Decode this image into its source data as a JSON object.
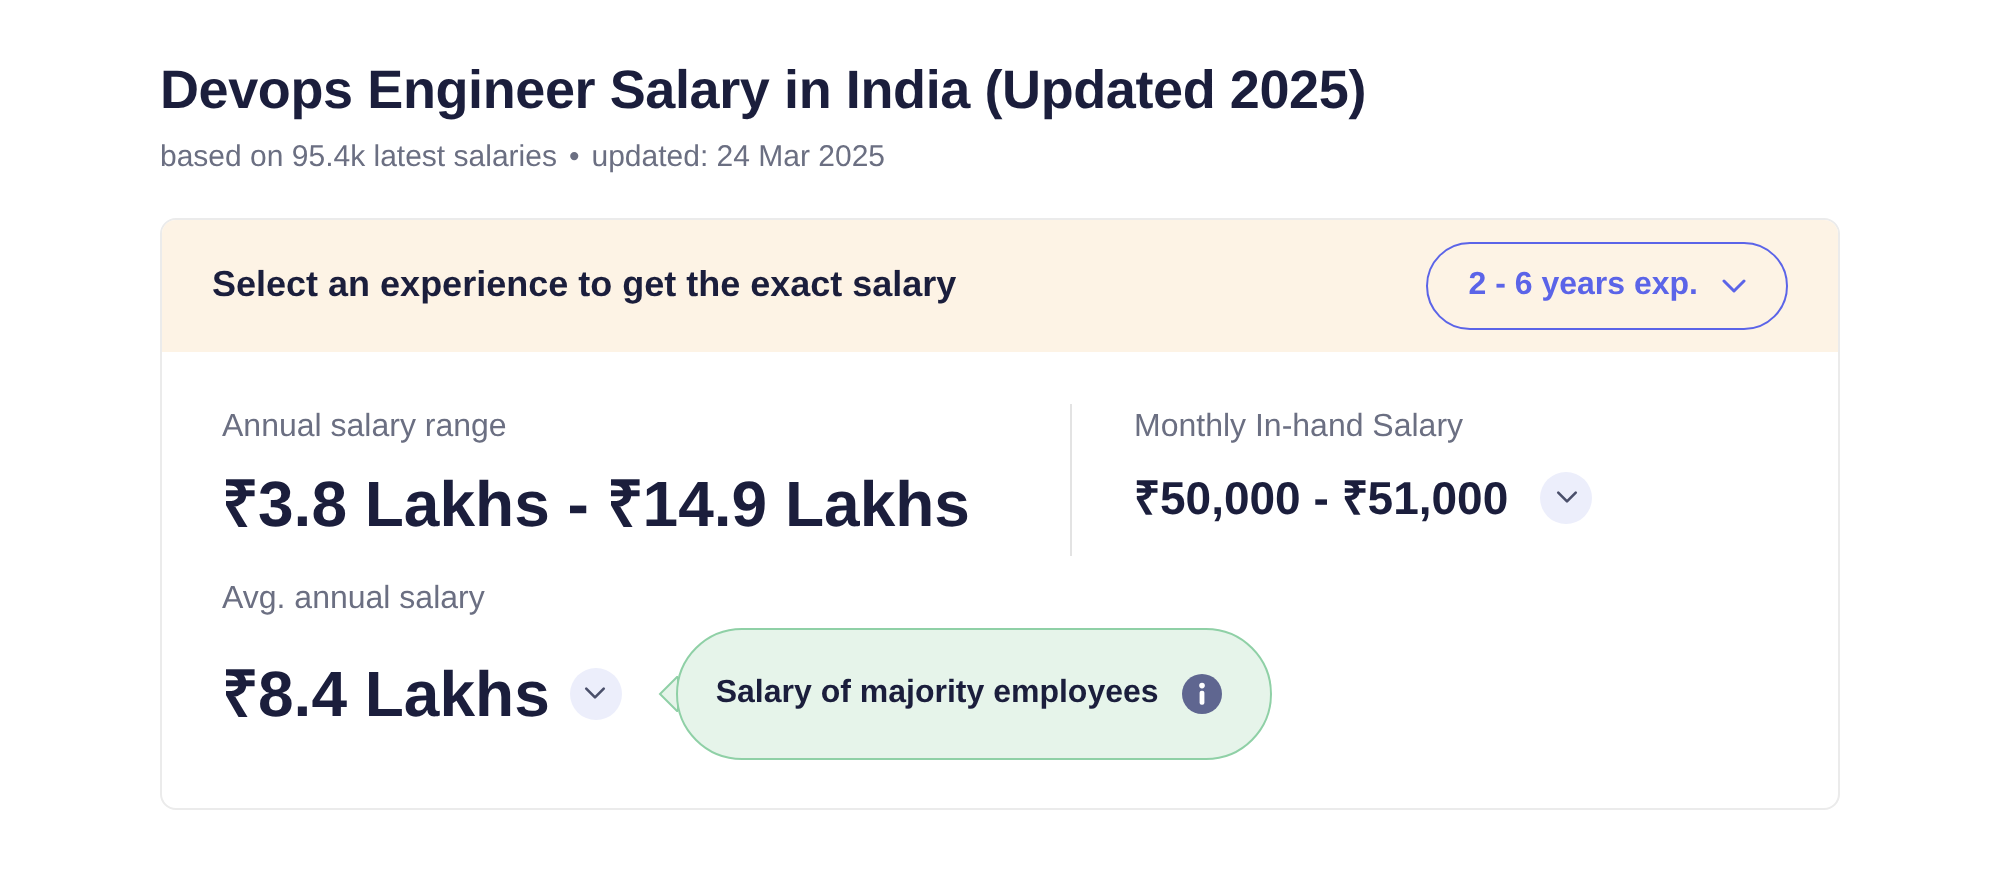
{
  "title": "Devops Engineer Salary in India (Updated 2025)",
  "subtitle": {
    "based_on": "based on 95.4k latest salaries",
    "separator": "•",
    "updated": "updated: 24 Mar 2025"
  },
  "experience_bar": {
    "prompt": "Select an experience to get the exact salary",
    "dropdown": "2 - 6 years exp."
  },
  "annual_range": {
    "label": "Annual salary range",
    "value": "₹3.8 Lakhs - ₹14.9 Lakhs"
  },
  "monthly": {
    "label": "Monthly In-hand Salary",
    "value": "₹50,000 - ₹51,000"
  },
  "average": {
    "label": "Avg. annual salary",
    "value": "₹8.4 Lakhs"
  },
  "tooltip": {
    "text": "Salary of majority employees"
  }
}
